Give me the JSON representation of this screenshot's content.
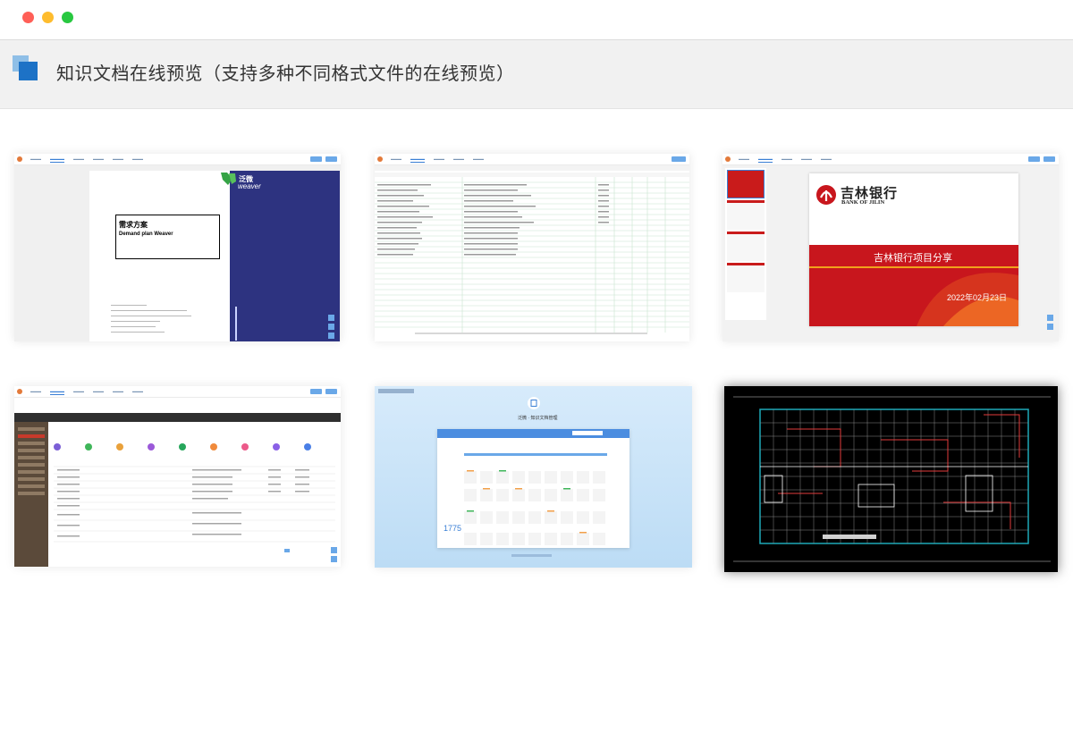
{
  "window": {
    "controls": [
      {
        "name": "close",
        "color": "#ff5f57"
      },
      {
        "name": "minimize",
        "color": "#febc2e"
      },
      {
        "name": "zoom",
        "color": "#28c840"
      }
    ]
  },
  "header": {
    "title": "知识文档在线预览（支持多种不同格式文件的在线预览）",
    "logo_colors": {
      "back": "#8fbfe7",
      "front": "#1d72c6"
    }
  },
  "previews": {
    "word": {
      "title_cn": "需求方案",
      "title_en": "Demand plan Weaver",
      "brand": "泛微",
      "brand_en": "weaver"
    },
    "ppt": {
      "bank_cn": "吉林银行",
      "bank_en": "BANK OF JILIN",
      "subject": "吉林银行项目分享",
      "date": "2022年02月23日"
    },
    "portal": {
      "brand": "泛微 · 知识文档管理",
      "count": "1775"
    }
  }
}
